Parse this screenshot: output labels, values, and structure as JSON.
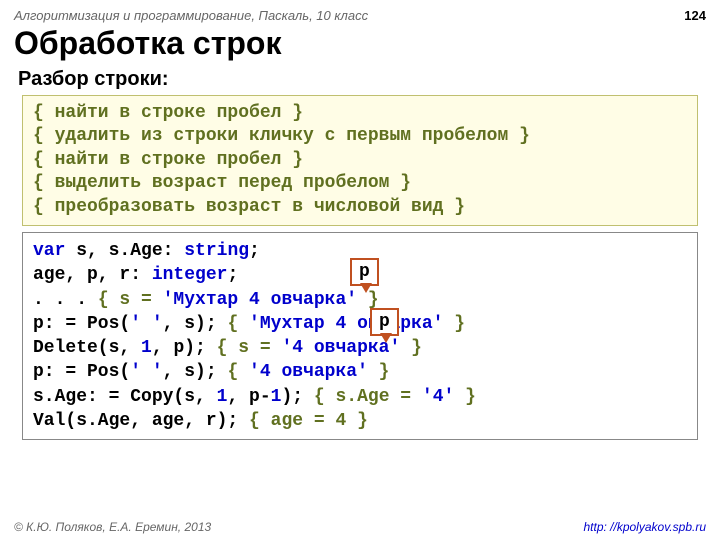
{
  "header": {
    "course": "Алгоритмизация и программирование, Паскаль, 10 класс",
    "page": "124"
  },
  "title": "Обработка строк",
  "sub": "Разбор строки:",
  "comments": {
    "l1": "{ найти в строке пробел }",
    "l2": "{ удалить из строки кличку с первым пробелом }",
    "l3": "{ найти в строке пробел }",
    "l4": "{ выделить возраст перед пробелом }",
    "l5": "{ преобразовать возраст в числовой вид }"
  },
  "code": {
    "l1a": "var",
    "l1b": " s, s.Age: ",
    "l1c": "string",
    "l1d": ";",
    "l2a": "    age, p, r: ",
    "l2b": "integer",
    "l2c": ";",
    "l3a": ". . . ",
    "l3b": "{ s = ",
    "l3c": "'Мухтар 4 овчарка'",
    "l3d": " }",
    "l4a": "p: = Pos(",
    "l4b": "' '",
    "l4c": ", s); ",
    "l4d": "{ ",
    "l4e": "'Мухтар 4 овчарка'",
    "l4f": " }",
    "l5a": "Delete(s, ",
    "l5b": "1",
    "l5c": ", p); ",
    "l5d": "{   s = ",
    "l5e": "'4 овчарка'",
    "l5f": " }",
    "l6a": "p: = Pos(",
    "l6b": "' '",
    "l6c": ", s); ",
    "l6d": "{       ",
    "l6e": "'4 овчарка'",
    "l6f": " }",
    "l7a": "s.Age: = Copy(s, ",
    "l7b": "1",
    "l7c": ", p-",
    "l7d": "1",
    "l7e": "); ",
    "l7f": "{ s.Age = ",
    "l7g": "'4'",
    "l7h": " }",
    "l8a": "Val(s.Age, age, r); ",
    "l8b": "{ age = 4 }"
  },
  "annot": {
    "p1": "p",
    "p2": "p"
  },
  "footer": {
    "left": "© К.Ю. Поляков, Е.А. Еремин, 2013",
    "right": "http: //kpolyakov.spb.ru"
  }
}
